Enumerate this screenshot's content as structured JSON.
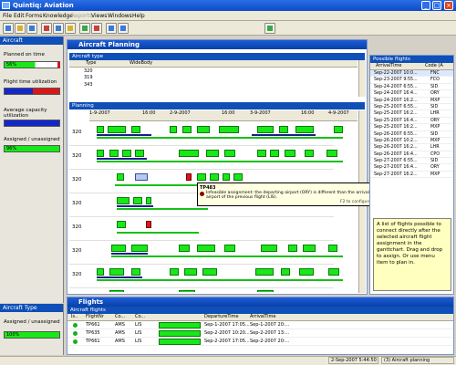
{
  "window": {
    "title": "Quintiq: Aviation"
  },
  "menu": [
    {
      "label": "File",
      "enabled": true
    },
    {
      "label": "Edit",
      "enabled": true
    },
    {
      "label": "Forms",
      "enabled": true
    },
    {
      "label": "Knowledge",
      "enabled": true
    },
    {
      "label": "Reports",
      "enabled": false
    },
    {
      "label": "Views",
      "enabled": true
    },
    {
      "label": "Windows",
      "enabled": true
    },
    {
      "label": "Help",
      "enabled": true
    }
  ],
  "left": {
    "title": "Aircraft",
    "planned_label": "Planned on time",
    "planned_value": "56%",
    "planned_fill": 0.56,
    "flight_util_label": "Flight time utilization",
    "avg_cap_label": "Average capacity utilization",
    "assigned_label": "Assigned / unassigned",
    "assigned_value": "96%",
    "assigned_fill": 0.96,
    "type_title": "Aircraft Type",
    "type_assigned_label": "Assigned / unassigned",
    "type_assigned_value": "100%",
    "type_assigned_fill": 1.0
  },
  "planning": {
    "title": "Aircraft Planning",
    "type_section": "Aircraft type",
    "col_type": "Type",
    "col_widebody": "WideBody",
    "types": [
      "320",
      "319",
      "343"
    ],
    "planning_section": "Planning",
    "dates": [
      "1-9-2007",
      "16:00",
      "2-9-2007",
      "16:00",
      "3-9-2007",
      "16:00",
      "4-9-2007",
      "16:00"
    ],
    "rows": [
      "320",
      "320",
      "320",
      "320",
      "320",
      "320",
      "320",
      "320",
      "320"
    ],
    "tooltip_title": "TP483",
    "tooltip_text": "Infeasible assignment: the departing airport (ORY) is different than the arrival airport of the previous flight (LIS).",
    "tooltip_hint": "F2 to configure"
  },
  "possible": {
    "title": "Possible flights",
    "col_arrival": "ArrivalTime",
    "col_code": "Code (A",
    "rows": [
      [
        "Sep-22-2007 10:0...",
        "FNC"
      ],
      [
        "Sep-23-2007 9:55...",
        "FCO"
      ],
      [
        "Sep-24-2007 6:55...",
        "SID"
      ],
      [
        "Sep-24-2007 16:4...",
        "ORY"
      ],
      [
        "Sep-24-2007 16:2...",
        "MXP"
      ],
      [
        "Sep-25-2007 6:55...",
        "SID"
      ],
      [
        "Sep-25-2007 16:2...",
        "LHR"
      ],
      [
        "Sep-25-2007 16:4...",
        "ORY"
      ],
      [
        "Sep-25-2007 16:2...",
        "MXP"
      ],
      [
        "Sep-26-2007 6:55...",
        "SID"
      ],
      [
        "Sep-26-2007 10:2...",
        "MXP"
      ],
      [
        "Sep-26-2007 16:2...",
        "LHR"
      ],
      [
        "Sep-26-2007 16:4...",
        "CPO"
      ],
      [
        "Sep-27-2007 6:55...",
        "SID"
      ],
      [
        "Sep-27-2007 16:4...",
        "ORY"
      ],
      [
        "Sep-27-2007 16:2...",
        "MXP"
      ]
    ],
    "help_text": "A list of flights possible to connect directly after the selected aircraft flight assignment in the ganttchart. Drag and drop to assign. Or use menu item to plan in."
  },
  "flights": {
    "title": "Flights",
    "section": "Aircraft flights",
    "cols": [
      "Is..",
      "FlightNr",
      "Co...",
      "Co...",
      "",
      "DepartureTime",
      "ArrivalTime"
    ],
    "rows": [
      [
        "TP661",
        "AMS",
        "LIS",
        "Sep-1-2007 17:05...",
        "Sep-1-2007 20:..."
      ],
      [
        "TP635",
        "AMS",
        "LIS",
        "Sep-2-2007 10:20...",
        "Sep-2-2007 13:..."
      ],
      [
        "TP661",
        "AMS",
        "LIS",
        "Sep-2-2007 17:05...",
        "Sep-2-2007 20:..."
      ]
    ]
  },
  "status": {
    "datetime": "2-Sep-2007 5:44:50",
    "view": "(3) Aircraft planning"
  }
}
